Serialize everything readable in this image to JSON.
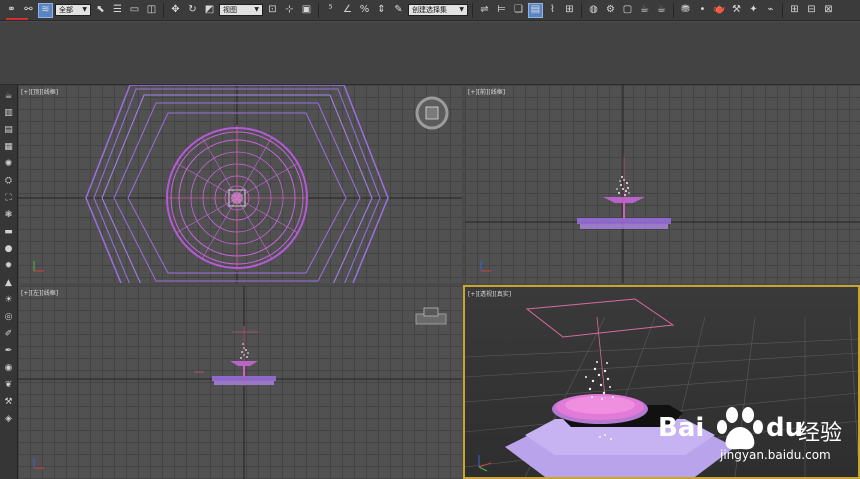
{
  "toolbar": {
    "selection_filter": "全部",
    "reference_coord": "视图",
    "named_selection": "创建选择集"
  },
  "viewports": {
    "top": {
      "label": "[+][顶][线框]"
    },
    "front": {
      "label": "[+][前][线框]"
    },
    "left": {
      "label": "[+][左][线框]"
    },
    "perspective": {
      "label": "[+][透视][真实]"
    }
  },
  "watermark": {
    "brand_latin": "Bai",
    "brand_latin_suffix": "du",
    "brand_cn": "经验",
    "url": "jingyan.baidu.com"
  },
  "colors": {
    "wire_purple": "#9b6fe0",
    "wire_pink": "#d457d8",
    "highlight_gold": "#c9a531",
    "active_blue": "#5a85c4"
  }
}
